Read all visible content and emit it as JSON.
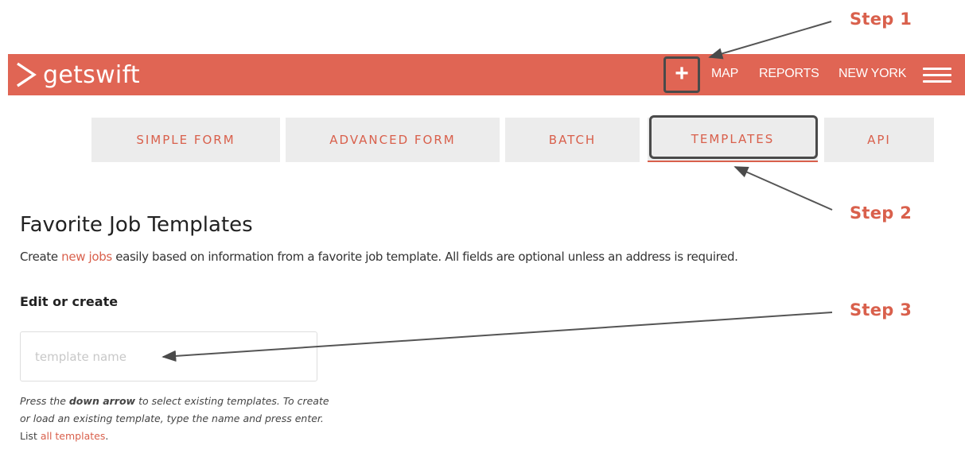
{
  "annotations": {
    "step1": "Step 1",
    "step2": "Step 2",
    "step3": "Step 3"
  },
  "header": {
    "brand": "getswift",
    "add_label": "+",
    "nav": {
      "map": "MAP",
      "reports": "REPORTS",
      "city": "NEW YORK"
    },
    "background_color": "#e06554"
  },
  "tabs": [
    {
      "label": "SIMPLE FORM"
    },
    {
      "label": "ADVANCED FORM"
    },
    {
      "label": "BATCH"
    },
    {
      "label": "TEMPLATES",
      "active": true
    },
    {
      "label": "API"
    }
  ],
  "main": {
    "title": "Favorite Job Templates",
    "subtitle_pre": "Create ",
    "subtitle_link": "new jobs",
    "subtitle_post": " easily based on information from a favorite job template. All fields are optional unless an address is required.",
    "section_label": "Edit or create",
    "input_placeholder": "template name",
    "help_1": "Press the ",
    "help_bold": "down arrow",
    "help_2": " to select existing templates. To create or load an existing template, type the name and press enter.",
    "help_3": " List ",
    "help_link": "all templates",
    "help_4": "."
  },
  "colors": {
    "accent": "#d9604c",
    "tab_background": "#ececec",
    "highlight_border": "#4a4a4a"
  }
}
